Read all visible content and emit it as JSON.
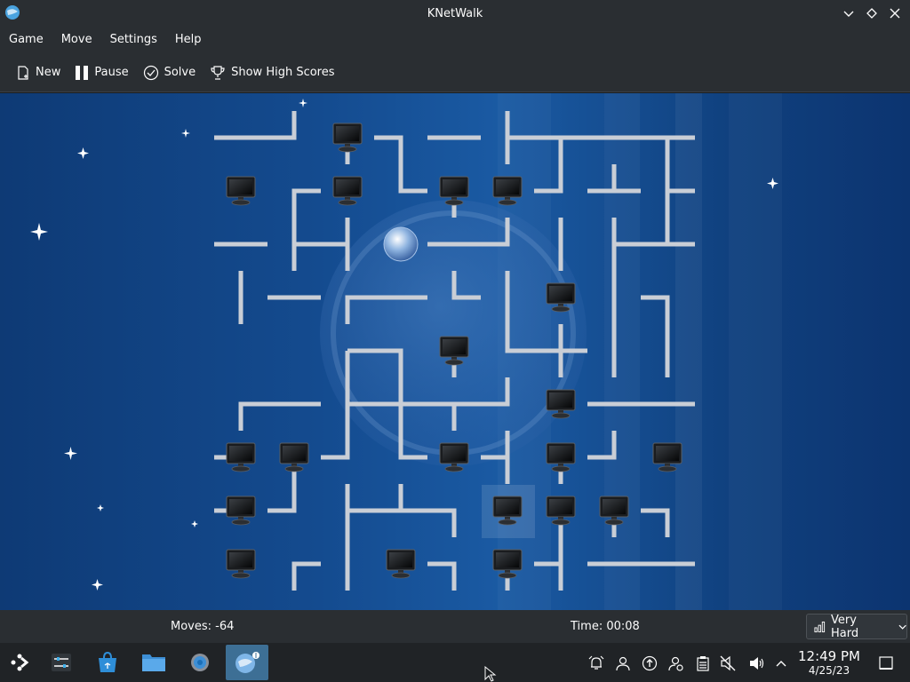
{
  "window": {
    "title": "KNetWalk"
  },
  "menu": {
    "items": [
      "Game",
      "Move",
      "Settings",
      "Help"
    ]
  },
  "toolbar": {
    "new": "New",
    "pause": "Pause",
    "solve": "Solve",
    "high_scores": "Show High Scores"
  },
  "status": {
    "moves": "Moves: -64",
    "time": "Time: 00:08",
    "difficulty": "Very Hard"
  },
  "clock": {
    "time": "12:49 PM",
    "date": "4/25/23"
  },
  "colors": {
    "background_blue": "#144b8f",
    "window_bg": "#2a2e32",
    "taskbar_bg": "#202326",
    "active_task": "#3d6f95",
    "pipe": "#c9ced6"
  }
}
